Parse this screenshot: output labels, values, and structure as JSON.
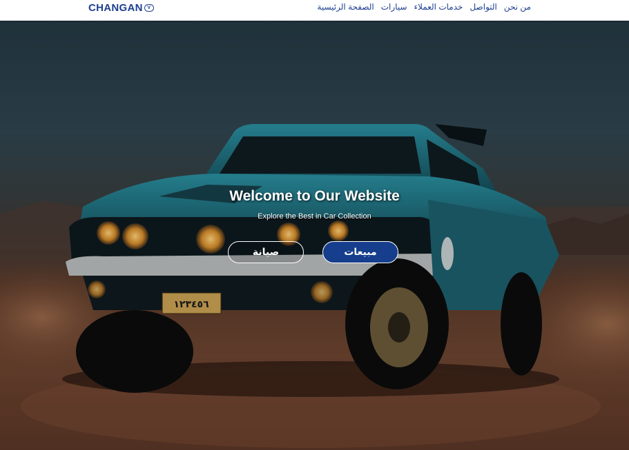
{
  "brand": {
    "name": "CHANGAN",
    "badge": "V"
  },
  "nav": {
    "items": [
      {
        "label": "الصفحة الرئيسية"
      },
      {
        "label": "سيارات"
      },
      {
        "label": "خدمات العملاء"
      },
      {
        "label": "التواصل"
      },
      {
        "label": "من نحن"
      }
    ]
  },
  "hero": {
    "title": "Welcome to Our Website",
    "subtitle": "Explore the Best in Car Collection",
    "buttons": {
      "maintenance": "صيانة",
      "sales": "مبيعات"
    },
    "plate_text": "١٢٣٤٥٦"
  },
  "colors": {
    "brand_blue": "#1d3f8f",
    "primary_button": "#163e8c",
    "car_teal": "#1f6f80"
  }
}
